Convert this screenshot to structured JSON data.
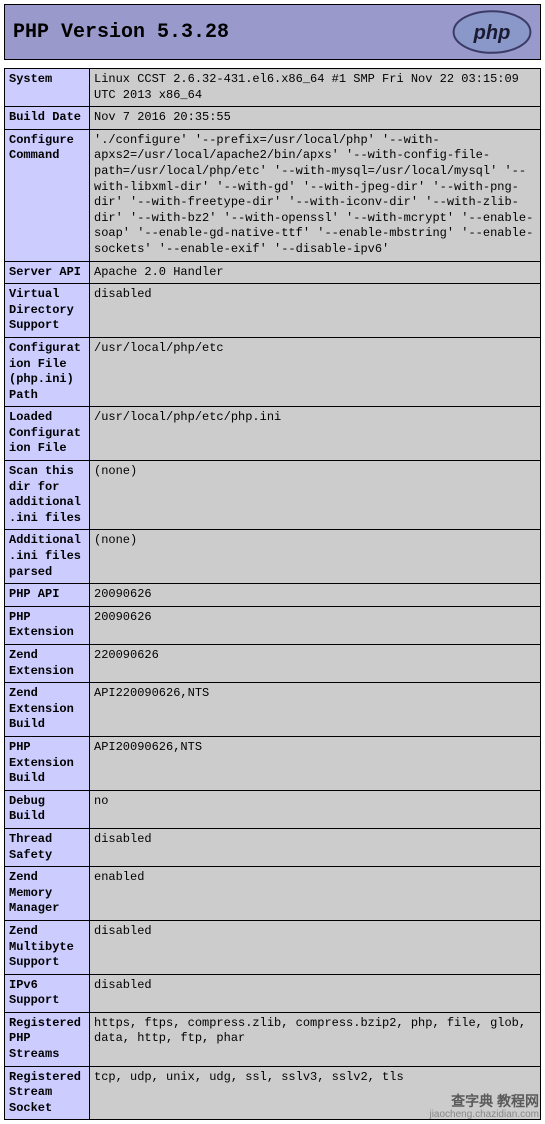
{
  "header": {
    "title": "PHP Version 5.3.28",
    "logo_alt": "php"
  },
  "rows": [
    {
      "key": "System",
      "val": "Linux CCST 2.6.32-431.el6.x86_64 #1 SMP Fri Nov 22 03:15:09 UTC 2013 x86_64"
    },
    {
      "key": "Build Date",
      "val": "Nov 7 2016 20:35:55"
    },
    {
      "key": "Configure Command",
      "val": "'./configure' '--prefix=/usr/local/php' '--with-apxs2=/usr/local/apache2/bin/apxs' '--with-config-file-path=/usr/local/php/etc' '--with-mysql=/usr/local/mysql' '--with-libxml-dir' '--with-gd' '--with-jpeg-dir' '--with-png-dir' '--with-freetype-dir' '--with-iconv-dir' '--with-zlib-dir' '--with-bz2' '--with-openssl' '--with-mcrypt' '--enable-soap' '--enable-gd-native-ttf' '--enable-mbstring' '--enable-sockets' '--enable-exif' '--disable-ipv6'"
    },
    {
      "key": "Server API",
      "val": "Apache 2.0 Handler"
    },
    {
      "key": "Virtual Directory Support",
      "val": "disabled"
    },
    {
      "key": "Configuration File (php.ini) Path",
      "val": "/usr/local/php/etc"
    },
    {
      "key": "Loaded Configuration File",
      "val": "/usr/local/php/etc/php.ini"
    },
    {
      "key": "Scan this dir for additional .ini files",
      "val": "(none)"
    },
    {
      "key": "Additional .ini files parsed",
      "val": "(none)"
    },
    {
      "key": "PHP API",
      "val": "20090626"
    },
    {
      "key": "PHP Extension",
      "val": "20090626"
    },
    {
      "key": "Zend Extension",
      "val": "220090626"
    },
    {
      "key": "Zend Extension Build",
      "val": "API220090626,NTS"
    },
    {
      "key": "PHP Extension Build",
      "val": "API20090626,NTS"
    },
    {
      "key": "Debug Build",
      "val": "no"
    },
    {
      "key": "Thread Safety",
      "val": "disabled"
    },
    {
      "key": "Zend Memory Manager",
      "val": "enabled"
    },
    {
      "key": "Zend Multibyte Support",
      "val": "disabled"
    },
    {
      "key": "IPv6 Support",
      "val": "disabled"
    },
    {
      "key": "Registered PHP Streams",
      "val": "https, ftps, compress.zlib, compress.bzip2, php, file, glob, data, http, ftp, phar"
    },
    {
      "key": "Registered Stream Socket",
      "val": "tcp, udp, unix, udg, ssl, sslv3, sslv2, tls"
    }
  ],
  "watermark": {
    "cn": "查字典 教程网",
    "domain": "jiaocheng.chazidian.com"
  }
}
